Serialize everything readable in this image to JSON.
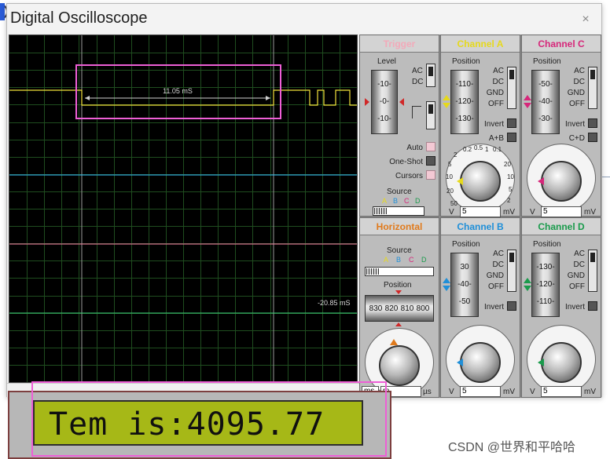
{
  "window": {
    "title": "Digital Oscilloscope",
    "close_glyph": "×"
  },
  "screen": {
    "measure_label": "11.05 mS",
    "cursor_label": "-20.85 mS",
    "trace_colors": {
      "a": "#f2e33b",
      "b": "#35c0ff",
      "c": "#ff7fa8",
      "d": "#3bd17a"
    }
  },
  "trigger": {
    "title": "Trigger",
    "level_label": "Level",
    "ticks": [
      "-10-",
      "-0-",
      "-10-"
    ],
    "ac": "AC",
    "dc": "DC",
    "auto": "Auto",
    "one_shot": "One-Shot",
    "cursors": "Cursors",
    "source_label": "Source",
    "source_letters": [
      "A",
      "B",
      "C",
      "D"
    ]
  },
  "channel_a": {
    "title": "Channel A",
    "position_label": "Position",
    "ticks": [
      "-110-",
      "-120-",
      "-130-"
    ],
    "modes": [
      "AC",
      "DC",
      "GND",
      "OFF"
    ],
    "invert": "Invert",
    "combine": "A+B",
    "dial": [
      "0.2",
      "0.5",
      "1",
      "2",
      "5",
      "10",
      "20",
      "50",
      "0.1",
      "20",
      "10",
      "5",
      "2",
      "1",
      "0.5",
      "200",
      "100",
      "50",
      "20"
    ],
    "unit_left": "V",
    "value": "5",
    "unit_right": "mV",
    "color": "#e6d91c"
  },
  "channel_c": {
    "title": "Channel C",
    "position_label": "Position",
    "ticks": [
      "-50-",
      "-40-",
      "-30-"
    ],
    "modes": [
      "AC",
      "DC",
      "GND",
      "OFF"
    ],
    "invert": "Invert",
    "combine": "C+D",
    "unit_left": "V",
    "value": "5",
    "unit_right": "mV",
    "color": "#d6277a"
  },
  "horizontal": {
    "title": "Horizontal",
    "source_label": "Source",
    "source_letters": [
      "A",
      "B",
      "C",
      "D"
    ],
    "position_label": "Position",
    "position_values": [
      "830",
      "820",
      "810",
      "800"
    ],
    "unit_left": "ms",
    "value": "m",
    "unit_right": "µs",
    "color": "#e07a1c"
  },
  "channel_b": {
    "title": "Channel B",
    "position_label": "Position",
    "ticks": [
      "30",
      "-40-",
      "-50"
    ],
    "modes": [
      "AC",
      "DC",
      "GND",
      "OFF"
    ],
    "invert": "Invert",
    "unit_left": "V",
    "value": "5",
    "unit_right": "mV",
    "color": "#1f8fd8"
  },
  "channel_d": {
    "title": "Channel D",
    "position_label": "Position",
    "ticks": [
      "-130-",
      "-120-",
      "-110-"
    ],
    "modes": [
      "AC",
      "DC",
      "GND",
      "OFF"
    ],
    "invert": "Invert",
    "unit_left": "V",
    "value": "5",
    "unit_right": "mV",
    "color": "#1a9b4c"
  },
  "lcd": {
    "text": "Tem is:4095.77"
  },
  "watermark": "CSDN @世界和平哈哈"
}
